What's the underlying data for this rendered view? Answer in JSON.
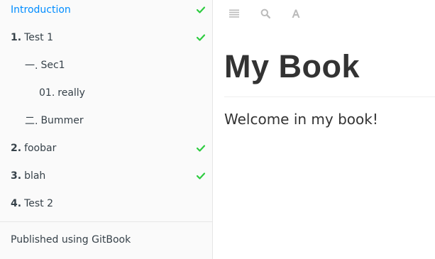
{
  "sidebar": {
    "items": [
      {
        "num": "",
        "label": "Introduction",
        "done": true,
        "active": true
      },
      {
        "num": "1.",
        "label": "Test 1",
        "done": true,
        "active": false
      },
      {
        "num": "一.",
        "label": "Sec1",
        "done": false,
        "active": false
      },
      {
        "num": "01.",
        "label": "really",
        "done": false,
        "active": false
      },
      {
        "num": "二.",
        "label": "Bummer",
        "done": false,
        "active": false
      },
      {
        "num": "2.",
        "label": "foobar",
        "done": true,
        "active": false
      },
      {
        "num": "3.",
        "label": "blah",
        "done": true,
        "active": false
      },
      {
        "num": "4.",
        "label": "Test 2",
        "done": false,
        "active": false
      }
    ],
    "footer": "Published using GitBook"
  },
  "toolbar": {
    "buttons": [
      {
        "icon": "menu-icon"
      },
      {
        "icon": "search-icon"
      },
      {
        "icon": "font-settings-icon"
      }
    ]
  },
  "page": {
    "title": "My Book",
    "body": "Welcome in my book!"
  },
  "colors": {
    "accent": "#008cff",
    "check": "#2ecc40",
    "sidebar_bg": "#fafafa",
    "icon": "#bbbbbb"
  }
}
